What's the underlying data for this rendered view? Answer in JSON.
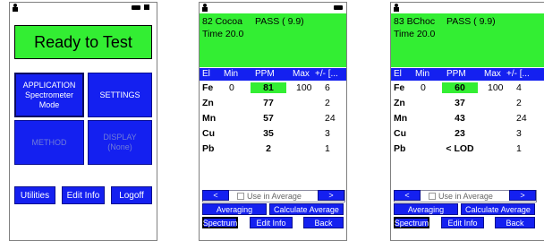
{
  "panel1": {
    "status_icons": [
      "person-icon",
      "battery-icon",
      "plug-icon"
    ],
    "banner": "Ready to Test",
    "tiles": [
      {
        "name": "application",
        "lines": [
          "APPLICATION",
          "Spectrometer",
          "Mode"
        ],
        "enabled": true,
        "selected": true
      },
      {
        "name": "settings",
        "lines": [
          "SETTINGS"
        ],
        "enabled": true,
        "selected": false
      },
      {
        "name": "method",
        "lines": [
          "METHOD"
        ],
        "enabled": false,
        "selected": false
      },
      {
        "name": "display",
        "lines": [
          "DISPLAY",
          "(None)"
        ],
        "enabled": false,
        "selected": false
      }
    ],
    "buttons": {
      "utilities": "Utilities",
      "edit_info": "Edit Info",
      "logoff": "Logoff"
    }
  },
  "panel2": {
    "sample": "82 Cocoa",
    "result": "PASS ( 9.9)",
    "time": "Time 20.0",
    "columns": [
      "El",
      "Min",
      "PPM",
      "Max",
      "+/- [..."
    ],
    "rows": [
      {
        "el": "Fe",
        "min": "0",
        "ppm": "81",
        "max": "100",
        "err": "6",
        "highlight": true
      },
      {
        "el": "Zn",
        "min": "",
        "ppm": "77",
        "max": "",
        "err": "2",
        "highlight": false
      },
      {
        "el": "Mn",
        "min": "",
        "ppm": "57",
        "max": "",
        "err": "24",
        "highlight": false
      },
      {
        "el": "Cu",
        "min": "",
        "ppm": "35",
        "max": "",
        "err": "3",
        "highlight": false
      },
      {
        "el": "Pb",
        "min": "",
        "ppm": "2",
        "max": "",
        "err": "1",
        "highlight": false
      }
    ],
    "nav": {
      "prev": "<",
      "use_avg": "Use in Average",
      "next": ">"
    },
    "buttons": {
      "averaging": "Averaging",
      "calc_avg": "Calculate Average",
      "spectrum": "Spectrum",
      "edit_info": "Edit Info",
      "back": "Back"
    }
  },
  "panel3": {
    "sample": "83 BChoc",
    "result": "PASS ( 9.9)",
    "time": "Time 20.0",
    "columns": [
      "El",
      "Min",
      "PPM",
      "Max",
      "+/- [..."
    ],
    "rows": [
      {
        "el": "Fe",
        "min": "0",
        "ppm": "60",
        "max": "100",
        "err": "4",
        "highlight": true
      },
      {
        "el": "Zn",
        "min": "",
        "ppm": "37",
        "max": "",
        "err": "2",
        "highlight": false
      },
      {
        "el": "Mn",
        "min": "",
        "ppm": "43",
        "max": "",
        "err": "24",
        "highlight": false
      },
      {
        "el": "Cu",
        "min": "",
        "ppm": "23",
        "max": "",
        "err": "3",
        "highlight": false
      },
      {
        "el": "Pb",
        "min": "",
        "ppm": "< LOD",
        "max": "",
        "err": "1",
        "highlight": false
      }
    ],
    "nav": {
      "prev": "<",
      "use_avg": "Use in Average",
      "next": ">"
    },
    "buttons": {
      "averaging": "Averaging",
      "calc_avg": "Calculate Average",
      "spectrum": "Spectrum",
      "edit_info": "Edit Info",
      "back": "Back"
    }
  },
  "colors": {
    "accent_green": "#33ee33",
    "button_blue": "#1420f0"
  }
}
